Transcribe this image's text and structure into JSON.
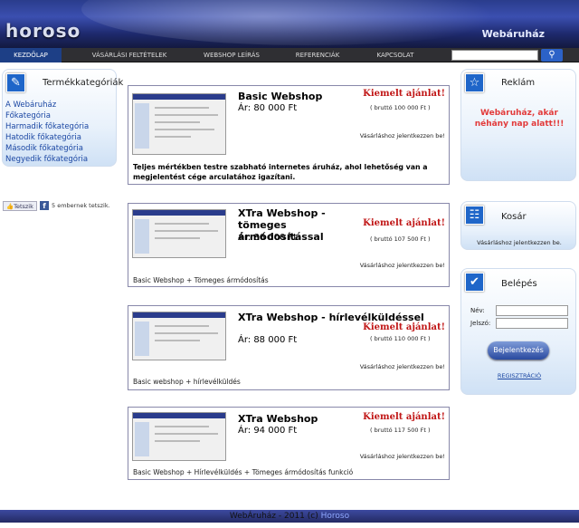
{
  "header": {
    "logo": "horoso",
    "site_title": "Webáruház"
  },
  "nav": {
    "items": [
      "KEZDŐLAP",
      "VÁSÁRLÁSI FELTÉTELEK",
      "WEBSHOP LEÍRÁS",
      "REFERENCIÁK",
      "KAPCSOLAT"
    ],
    "search_icon": "magnifier-icon"
  },
  "categories": {
    "title": "Termékkategóriák",
    "items": [
      "A Webáruház",
      "Főkategória",
      "Harmadik főkategória",
      "Hatodik főkategória",
      "Második főkategória",
      "Negyedik főkategória"
    ]
  },
  "social": {
    "like_label": "Tetszik",
    "fb_icon": "f",
    "count_text": "5 embernek tetszik."
  },
  "products": [
    {
      "name": "Basic Webshop",
      "price": "Ár: 80 000 Ft",
      "featured": "Kiemelt ajánlat!",
      "gross": "( bruttó 100 000 Ft )",
      "login_msg": "Vásárláshoz jelentkezzen be!",
      "desc": "Teljes mértékben testre szabható internetes áruház, ahol lehetőség van a megjelentést cége arculatához igazítani."
    },
    {
      "name": "XTra Webshop - tömeges ármódosítással",
      "price": "Ár: 86 000 Ft",
      "featured": "Kiemelt ajánlat!",
      "gross": "( bruttó 107 500 Ft )",
      "login_msg": "Vásárláshoz jelentkezzen be!",
      "desc": "Basic Webshop + Tömeges ármódosítás"
    },
    {
      "name": "XTra Webshop - hírlevélküldéssel",
      "price": "Ár: 88 000 Ft",
      "featured": "Kiemelt ajánlat!",
      "gross": "( bruttó 110 000 Ft )",
      "login_msg": "Vásárláshoz jelentkezzen be!",
      "desc": "Basic webshop + hírlevélküldés"
    },
    {
      "name": "XTra Webshop",
      "price": "Ár: 94 000 Ft",
      "featured": "Kiemelt ajánlat!",
      "gross": "( bruttó 117 500 Ft )",
      "login_msg": "Vásárláshoz jelentkezzen be!",
      "desc": "Basic Webshop + Hírlevélküldés + Tömeges ármódosítás funkció"
    }
  ],
  "ad": {
    "title": "Reklám",
    "text": "Webáruház, akár néhány nap alatt!!!"
  },
  "cart": {
    "title": "Kosár",
    "text": "Vásárláshoz jelentkezzen be."
  },
  "login": {
    "title": "Belépés",
    "name_label": "Név:",
    "password_label": "Jelszó:",
    "button_label": "Bejelentkezés",
    "register_label": "REGISZTRÁCIÓ"
  },
  "footer": {
    "text": "WebÁruház - 2011 (c)",
    "brand": "Horoso"
  },
  "colors": {
    "accent": "#1f66c9",
    "featured": "#c01515",
    "nav_bg": "#2f2f33"
  }
}
